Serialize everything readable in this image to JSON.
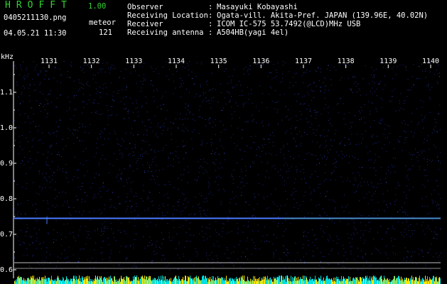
{
  "app": {
    "name": "HROFFT",
    "version": "1.00"
  },
  "file": {
    "name": "0405211130.png",
    "datetime": "04.05.21 11:30"
  },
  "detection": {
    "label": "meteor",
    "count": "121"
  },
  "meta": [
    {
      "label": "Observer",
      "value": "Masayuki Kobayashi"
    },
    {
      "label": "Receiving Location",
      "value": "Ogata-vill. Akita-Pref. JAPAN (139.96E, 40.02N)"
    },
    {
      "label": "Receiver",
      "value": "ICOM IC-575 53.7492(@LCD)MHz USB"
    },
    {
      "label": "Receiving antenna",
      "value": "A504HB(yagi 4el)"
    }
  ],
  "axis": {
    "unit": "kHz",
    "time_ticks": [
      "1131",
      "1132",
      "1133",
      "1134",
      "1135",
      "1136",
      "1137",
      "1138",
      "1139",
      "1140"
    ],
    "freq_ticks": [
      {
        "label": "1.1",
        "khz": 1.1
      },
      {
        "label": "1.0",
        "khz": 1.0
      },
      {
        "label": "0.9",
        "khz": 0.9
      },
      {
        "label": "0.8",
        "khz": 0.8
      },
      {
        "label": "0.7",
        "khz": 0.7
      },
      {
        "label": "0.6",
        "khz": 0.6
      }
    ]
  },
  "signal": {
    "carrier_khz": 0.745,
    "carrier_color": "#4a7cff",
    "reference_khz": 0.62
  },
  "colors": {
    "background": "#000000",
    "title_green": "#32d432",
    "text": "#ffffff",
    "noise_blue": "#1a2a8a",
    "bottom_cyan": "#00e0e0",
    "bottom_yellow": "#ffe600"
  }
}
